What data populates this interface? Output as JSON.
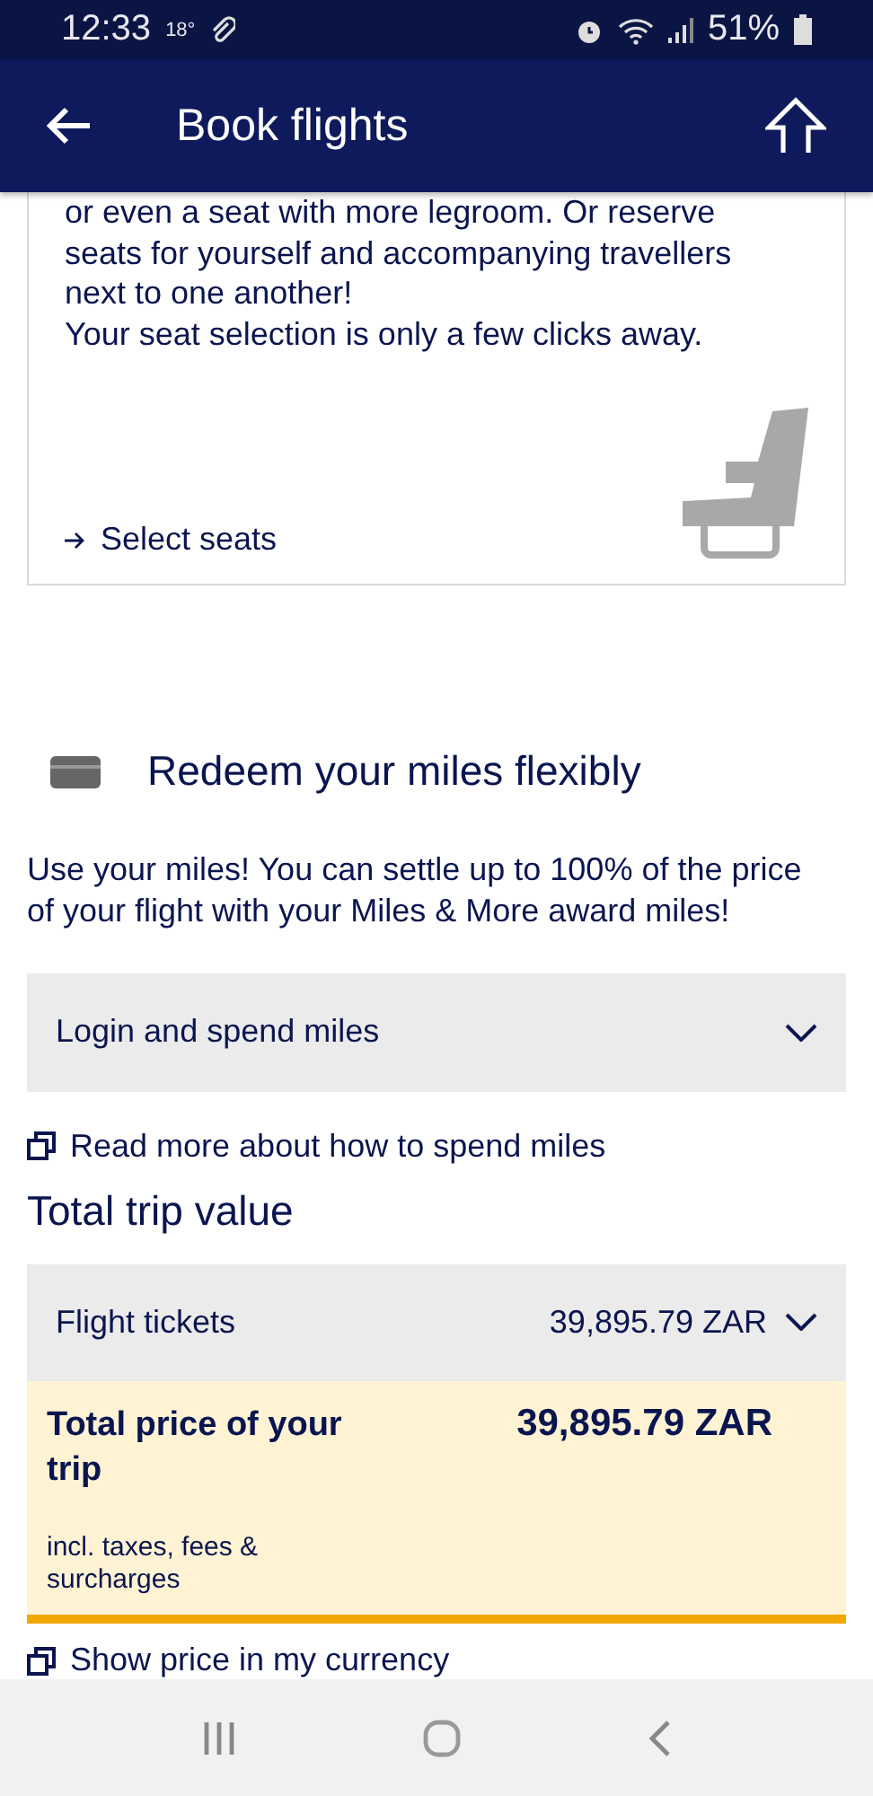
{
  "status_bar": {
    "time": "12:33",
    "temperature": "18°",
    "battery": "51%"
  },
  "header": {
    "title": "Book flights"
  },
  "seat_card": {
    "lines": [
      "or even a seat with more legroom. Or reserve",
      "seats for yourself and accompanying travellers",
      "next to one another!",
      "Your seat selection is only a few clicks away."
    ],
    "link": "Select seats"
  },
  "miles": {
    "title": "Redeem your miles flexibly",
    "text": "Use your miles! You can settle up to 100% of the price of your flight with your Miles & More award miles!",
    "dropdown": {
      "label": "Login and spend miles",
      "expanded": false
    },
    "link": "Read more about how to spend miles"
  },
  "trip": {
    "title": "Total trip value",
    "tickets": {
      "label": "Flight tickets",
      "amount": "39,895.79 ZAR",
      "expanded": false
    },
    "total": {
      "label": "Total price of your trip",
      "amount": "39,895.79 ZAR",
      "note": "incl. taxes, fees & surcharges"
    },
    "currency_link": "Show price in my currency"
  }
}
